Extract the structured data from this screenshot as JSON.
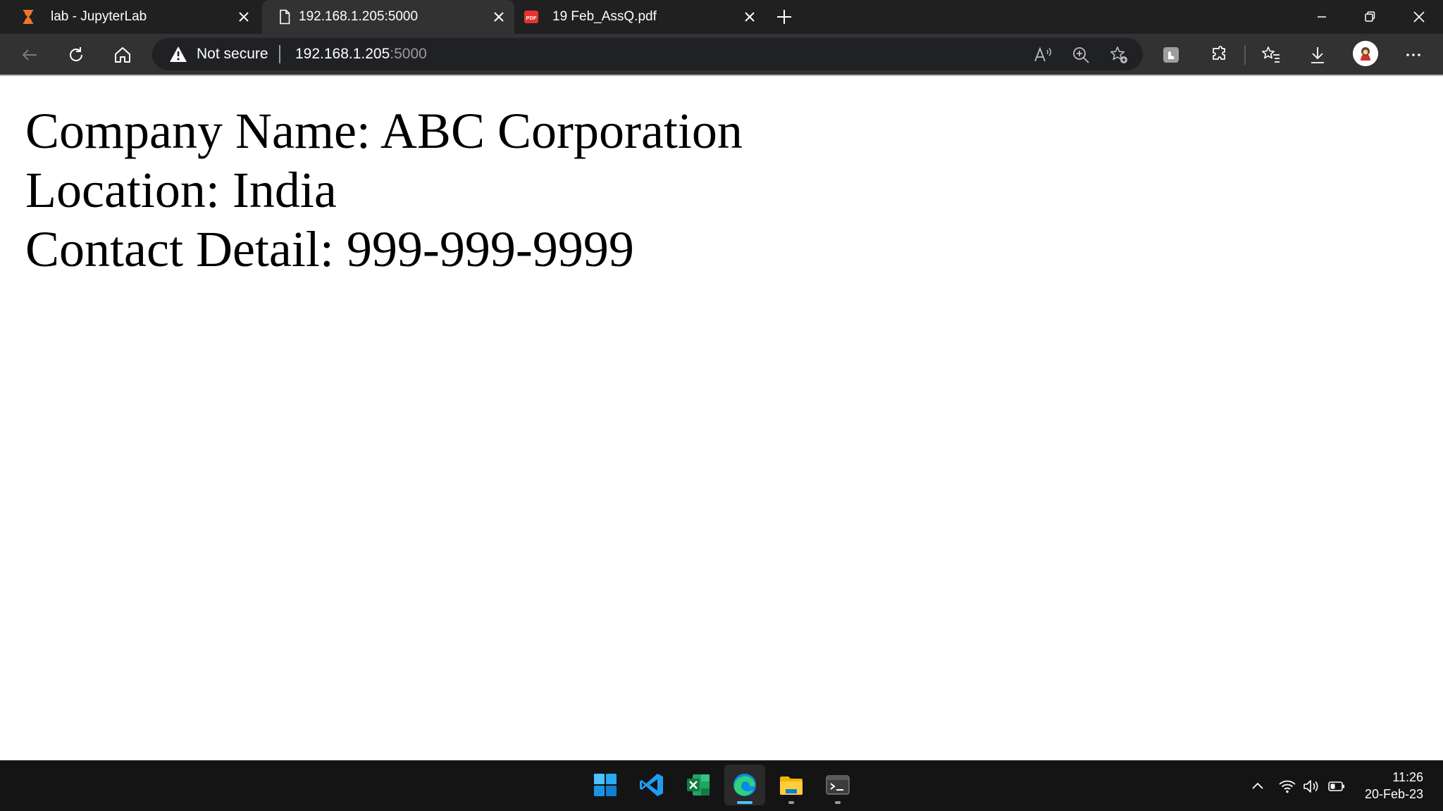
{
  "tabs": [
    {
      "title": "lab - JupyterLab",
      "icon": "jupyter-hourglass-icon",
      "active": false
    },
    {
      "title": "192.168.1.205:5000",
      "icon": "page-icon",
      "active": true
    },
    {
      "title": "19 Feb_AssQ.pdf",
      "icon": "pdf-icon",
      "active": false
    }
  ],
  "addressbar": {
    "security_text": "Not secure",
    "url_host": "192.168.1.205",
    "url_port": ":5000"
  },
  "page": {
    "company_line": "Company Name: ABC Corporation",
    "location_line": "Location: India",
    "contact_line": "Contact Detail: 999-999-9999"
  },
  "taskbar": {
    "apps": [
      "windows-start-icon",
      "vscode-icon",
      "excel-icon",
      "edge-icon",
      "file-explorer-icon",
      "terminal-icon"
    ]
  },
  "clock": {
    "time": "11:26",
    "date": "20-Feb-23"
  },
  "colors": {
    "tabstrip": "#202020",
    "toolbar": "#323233",
    "accent": "#0078d4",
    "jupyter_orange": "#f37626"
  }
}
